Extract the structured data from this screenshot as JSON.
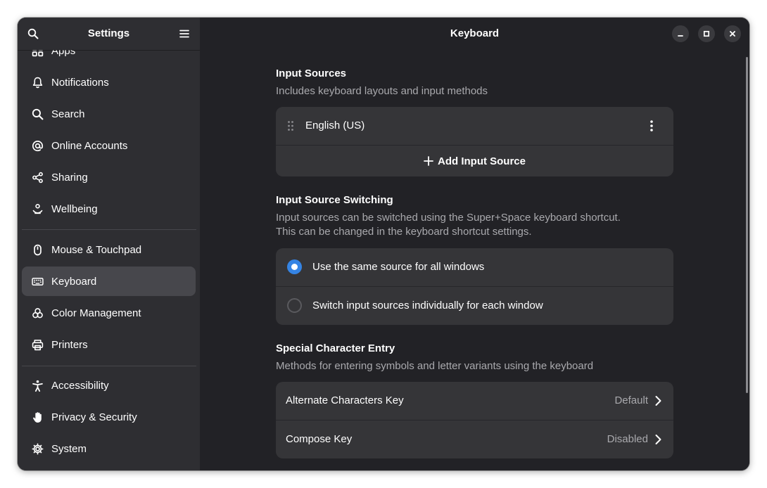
{
  "sidebar": {
    "title": "Settings",
    "search_icon": "search-icon",
    "menu_icon": "hamburger-menu-icon",
    "items": [
      {
        "label": "Apps",
        "icon": "apps-grid-icon"
      },
      {
        "label": "Notifications",
        "icon": "bell-icon"
      },
      {
        "label": "Search",
        "icon": "search-icon"
      },
      {
        "label": "Online Accounts",
        "icon": "at-sign-icon"
      },
      {
        "label": "Sharing",
        "icon": "share-icon"
      },
      {
        "label": "Wellbeing",
        "icon": "wellbeing-icon"
      },
      {
        "label": "Mouse & Touchpad",
        "icon": "mouse-icon"
      },
      {
        "label": "Keyboard",
        "icon": "keyboard-icon",
        "active": true
      },
      {
        "label": "Color Management",
        "icon": "color-circles-icon"
      },
      {
        "label": "Printers",
        "icon": "printer-icon"
      },
      {
        "label": "Accessibility",
        "icon": "accessibility-person-icon"
      },
      {
        "label": "Privacy & Security",
        "icon": "hand-icon"
      },
      {
        "label": "System",
        "icon": "gear-icon"
      }
    ]
  },
  "main": {
    "title": "Keyboard",
    "window_controls": [
      "minimize-icon",
      "maximize-icon",
      "close-icon"
    ],
    "input_sources": {
      "title": "Input Sources",
      "description": "Includes keyboard layouts and input methods",
      "sources": [
        {
          "label": "English (US)"
        }
      ],
      "add_label": "Add Input Source"
    },
    "switching": {
      "title": "Input Source Switching",
      "description_line1": "Input sources can be switched using the Super+Space keyboard shortcut.",
      "description_line2": "This can be changed in the keyboard shortcut settings.",
      "options": [
        {
          "label": "Use the same source for all windows",
          "selected": true
        },
        {
          "label": "Switch input sources individually for each window",
          "selected": false
        }
      ]
    },
    "special_chars": {
      "title": "Special Character Entry",
      "description": "Methods for entering symbols and letter variants using the keyboard",
      "rows": [
        {
          "label": "Alternate Characters Key",
          "value": "Default"
        },
        {
          "label": "Compose Key",
          "value": "Disabled"
        }
      ]
    }
  },
  "colors": {
    "accent": "#3584e4",
    "window_bg": "#222226",
    "sidebar_bg": "#2e2e32",
    "card_bg": "#353538"
  }
}
